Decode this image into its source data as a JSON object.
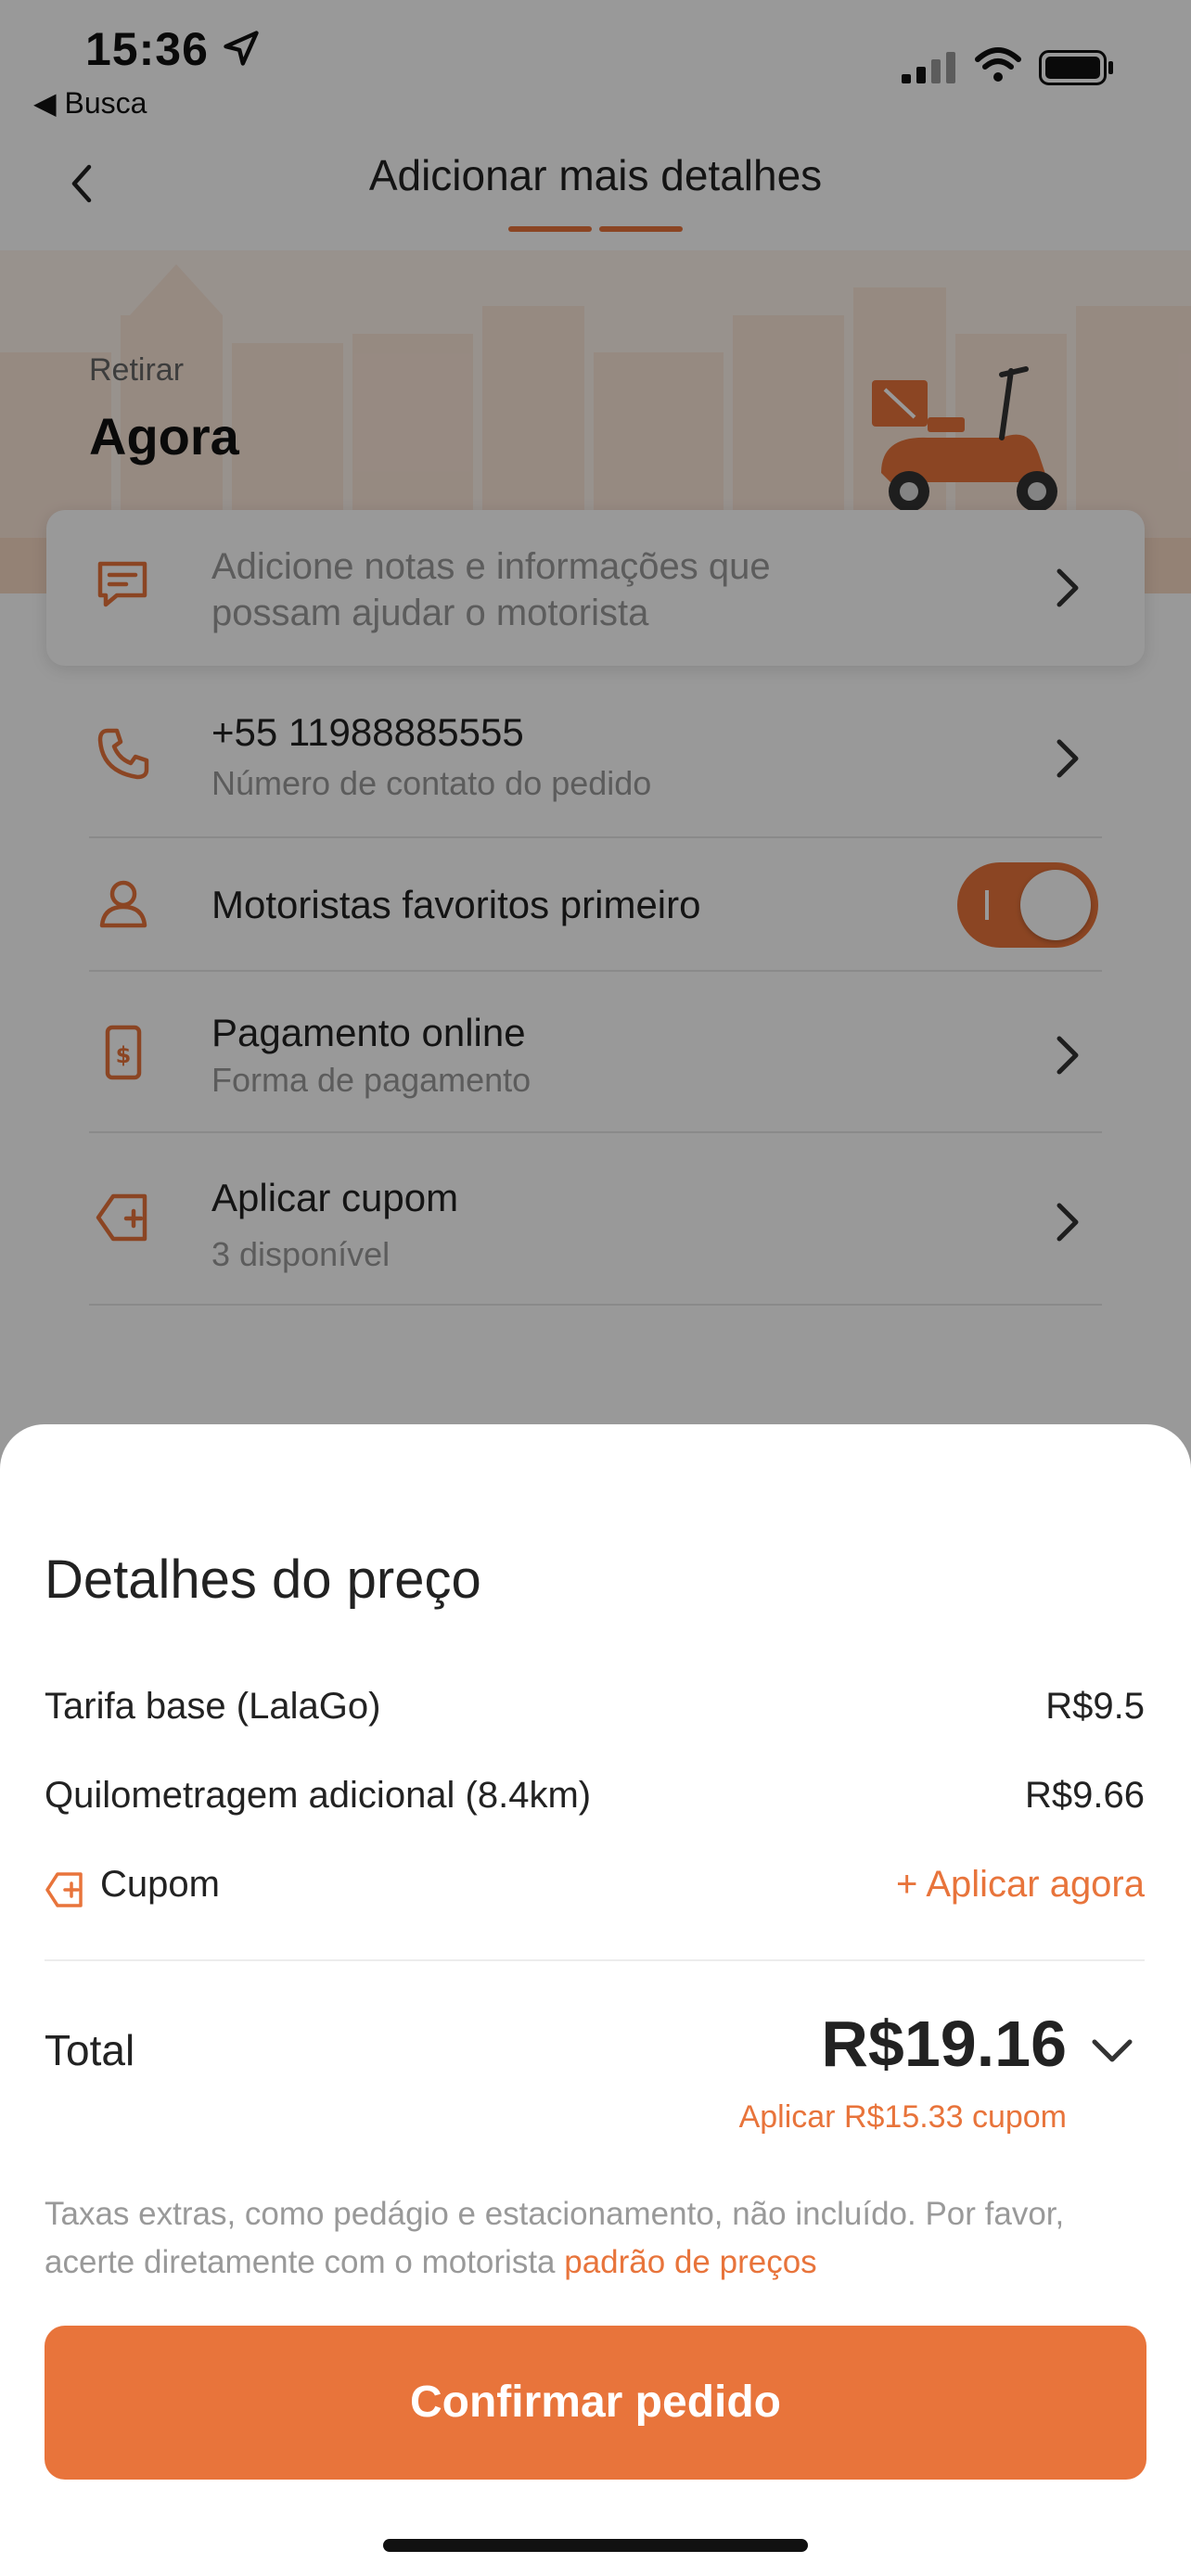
{
  "status_bar": {
    "time": "15:36",
    "back_app": "◀ Busca",
    "icons": [
      "location-arrow-icon",
      "cellular-signal-icon",
      "wifi-icon",
      "battery-icon"
    ]
  },
  "nav": {
    "title": "Adicionar mais detalhes",
    "progress_steps": 2,
    "progress_color": "#E8743B"
  },
  "pickup": {
    "label": "Retirar",
    "value": "Agora"
  },
  "notes": {
    "line1": "Adicione notas e informações que",
    "line2": "possam ajudar o motorista"
  },
  "rows": {
    "contact": {
      "title": "+55 11988885555",
      "subtitle": "Número de contato do pedido"
    },
    "favorites": {
      "title": "Motoristas favoritos primeiro",
      "toggle_on": true
    },
    "payment": {
      "title": "Pagamento online",
      "subtitle": "Forma de pagamento"
    },
    "coupon": {
      "title": "Aplicar cupom",
      "subtitle": "3 disponível"
    }
  },
  "price_details": {
    "title": "Detalhes do preço",
    "items": [
      {
        "label": "Tarifa base (LalaGo)",
        "value": "R$9.5"
      },
      {
        "label": "Quilometragem adicional (8.4km)",
        "value": "R$9.66"
      }
    ],
    "coupon_label": "Cupom",
    "coupon_action": "+ Aplicar agora",
    "total_label": "Total",
    "total_value": "R$19.16",
    "total_coupon_hint": "Aplicar R$15.33 cupom",
    "disclaimer": "Taxas extras, como pedágio e estacionamento, não incluído. Por favor, acerte diretamente com o motorista",
    "disclaimer_link": "padrão de preços",
    "confirm_label": "Confirmar pedido"
  },
  "colors": {
    "accent": "#E8743B",
    "text": "#222222",
    "muted": "#999999"
  }
}
